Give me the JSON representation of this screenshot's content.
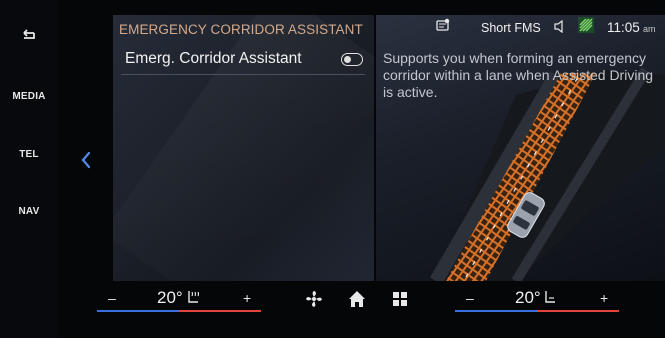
{
  "sidebar": {
    "items": [
      {
        "label": "MEDIA"
      },
      {
        "label": "TEL"
      },
      {
        "label": "NAV"
      }
    ]
  },
  "panel": {
    "title": "EMERGENCY CORRIDOR ASSISTANT",
    "setting_label": "Emerg. Corridor Assistant",
    "toggle_state": "off",
    "description": "Supports you when forming an emergency corridor within a lane when Assisted Driving is active."
  },
  "status_bar": {
    "profile": "Short FMS",
    "time": "11:05",
    "time_suffix": "am"
  },
  "climate": {
    "left": {
      "minus": "–",
      "temp": "20°",
      "plus": "+"
    },
    "right": {
      "minus": "–",
      "temp": "20°",
      "plus": "+"
    }
  },
  "colors": {
    "accent_title": "#d6a98a",
    "corridor_orange": "#e0762a",
    "temp_blue": "#3a6fe0",
    "temp_red": "#e0453a"
  },
  "icons": [
    "back-arrow-icon",
    "chevron-left-icon",
    "message-icon",
    "volume-icon",
    "signal-icon",
    "fan-icon",
    "home-icon",
    "apps-grid-icon",
    "seat-heat-icon",
    "seat-icon"
  ]
}
